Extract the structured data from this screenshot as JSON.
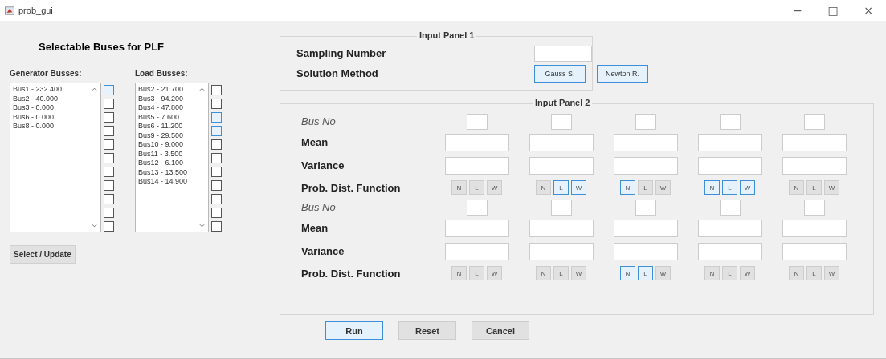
{
  "window": {
    "title": "prob_gui",
    "controls": [
      "−",
      "□",
      "×"
    ]
  },
  "bus_panel": {
    "title": "Selectable Buses for PLF",
    "generator": {
      "label": "Generator Busses:",
      "items": [
        "Bus1 - 232.400",
        "Bus2 - 40.000",
        "Bus3 - 0.000",
        "Bus6 - 0.000",
        "Bus8 - 0.000"
      ],
      "checkboxes": [
        {
          "checked": false,
          "highlighted": true
        },
        {
          "checked": false,
          "highlighted": false
        },
        {
          "checked": false,
          "highlighted": false
        },
        {
          "checked": false,
          "highlighted": false
        },
        {
          "checked": false,
          "highlighted": false
        },
        {
          "checked": false,
          "highlighted": false
        },
        {
          "checked": false,
          "highlighted": false
        },
        {
          "checked": false,
          "highlighted": false
        },
        {
          "checked": false,
          "highlighted": false
        },
        {
          "checked": false,
          "highlighted": false
        },
        {
          "checked": false,
          "highlighted": false
        }
      ]
    },
    "load": {
      "label": "Load Busses:",
      "items": [
        "Bus2 - 21.700",
        "Bus3 - 94.200",
        "Bus4 - 47.800",
        "Bus5 - 7.600",
        "Bus6 - 11.200",
        "Bus9 - 29.500",
        "Bus10 - 9.000",
        "Bus11 - 3.500",
        "Bus12 - 6.100",
        "Bus13 - 13.500",
        "Bus14 - 14.900"
      ],
      "checkboxes": [
        {
          "checked": false,
          "highlighted": false
        },
        {
          "checked": false,
          "highlighted": false
        },
        {
          "checked": false,
          "highlighted": true
        },
        {
          "checked": false,
          "highlighted": true
        },
        {
          "checked": false,
          "highlighted": false
        },
        {
          "checked": false,
          "highlighted": false
        },
        {
          "checked": false,
          "highlighted": false
        },
        {
          "checked": false,
          "highlighted": false
        },
        {
          "checked": false,
          "highlighted": false
        },
        {
          "checked": false,
          "highlighted": false
        },
        {
          "checked": false,
          "highlighted": false
        }
      ]
    },
    "button": "Select / Update"
  },
  "input_panel_1": {
    "title": "Input Panel 1",
    "sampling_label": "Sampling Number",
    "method_label": "Solution Method",
    "methods": [
      {
        "label": "Gauss S.",
        "highlighted": true
      },
      {
        "label": "Newton R.",
        "highlighted": true
      }
    ]
  },
  "input_panel_2": {
    "title": "Input Panel 2",
    "groups": [
      {
        "bus_label": "Bus No",
        "mean_label": "Mean",
        "variance_label": "Variance",
        "pdf_label": "Prob. Dist. Function",
        "columns": [
          {
            "pdf": [
              {
                "label": "N",
                "highlighted": false
              },
              {
                "label": "L",
                "highlighted": false
              },
              {
                "label": "W",
                "highlighted": false
              }
            ]
          },
          {
            "pdf": [
              {
                "label": "N",
                "highlighted": false
              },
              {
                "label": "L",
                "highlighted": true
              },
              {
                "label": "W",
                "highlighted": true
              }
            ]
          },
          {
            "pdf": [
              {
                "label": "N",
                "highlighted": true
              },
              {
                "label": "L",
                "highlighted": false
              },
              {
                "label": "W",
                "highlighted": false
              }
            ]
          },
          {
            "pdf": [
              {
                "label": "N",
                "highlighted": true
              },
              {
                "label": "L",
                "highlighted": true
              },
              {
                "label": "W",
                "highlighted": true
              }
            ]
          },
          {
            "pdf": [
              {
                "label": "N",
                "highlighted": false
              },
              {
                "label": "L",
                "highlighted": false
              },
              {
                "label": "W",
                "highlighted": false
              }
            ]
          }
        ]
      },
      {
        "bus_label": "Bus No",
        "mean_label": "Mean",
        "variance_label": "Variance",
        "pdf_label": "Prob. Dist. Function",
        "columns": [
          {
            "pdf": [
              {
                "label": "N",
                "highlighted": false
              },
              {
                "label": "L",
                "highlighted": false
              },
              {
                "label": "W",
                "highlighted": false
              }
            ]
          },
          {
            "pdf": [
              {
                "label": "N",
                "highlighted": false
              },
              {
                "label": "L",
                "highlighted": false
              },
              {
                "label": "W",
                "highlighted": false
              }
            ]
          },
          {
            "pdf": [
              {
                "label": "N",
                "highlighted": true
              },
              {
                "label": "L",
                "highlighted": true
              },
              {
                "label": "W",
                "highlighted": false
              }
            ]
          },
          {
            "pdf": [
              {
                "label": "N",
                "highlighted": false
              },
              {
                "label": "L",
                "highlighted": false
              },
              {
                "label": "W",
                "highlighted": false
              }
            ]
          },
          {
            "pdf": [
              {
                "label": "N",
                "highlighted": false
              },
              {
                "label": "L",
                "highlighted": false
              },
              {
                "label": "W",
                "highlighted": false
              }
            ]
          }
        ]
      }
    ]
  },
  "actions": [
    {
      "label": "Run",
      "highlighted": true
    },
    {
      "label": "Reset",
      "highlighted": false
    },
    {
      "label": "Cancel",
      "highlighted": false
    }
  ]
}
